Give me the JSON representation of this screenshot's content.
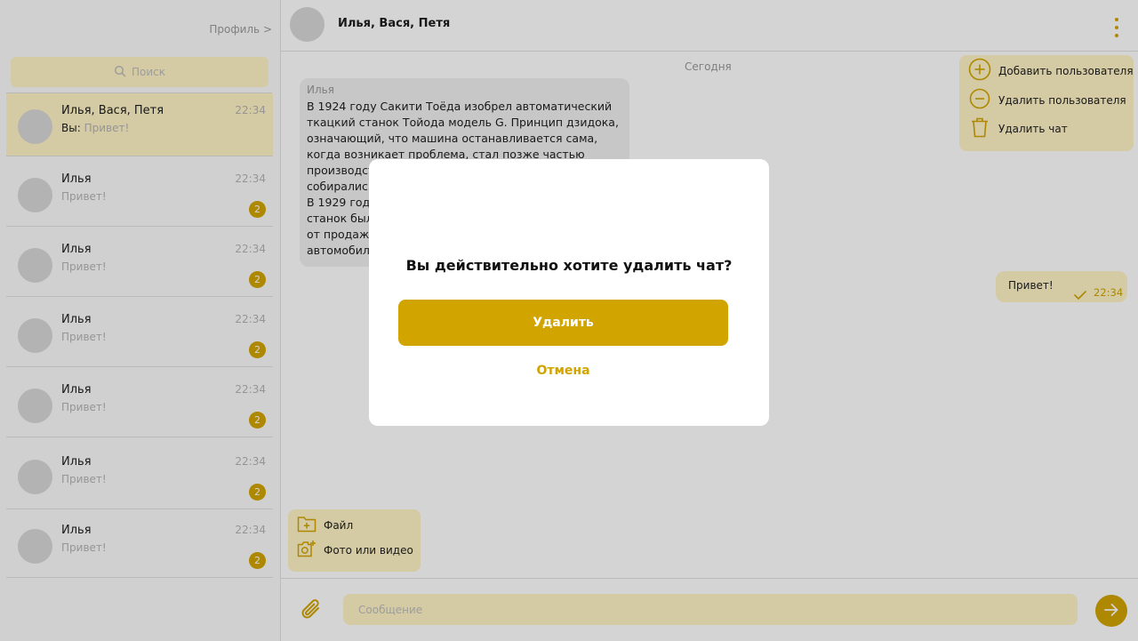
{
  "sidebar": {
    "profile_link": "Профиль >",
    "search_placeholder": "Поиск",
    "chats": [
      {
        "name": "Илья, Вася, Петя",
        "you_prefix": "Вы: ",
        "preview": "Привет!",
        "time": "22:34",
        "unread": "",
        "active": true
      },
      {
        "name": "Илья",
        "preview": "Привет!",
        "time": "22:34",
        "unread": "2"
      },
      {
        "name": "Илья",
        "preview": "Привет!",
        "time": "22:34",
        "unread": "2"
      },
      {
        "name": "Илья",
        "preview": "Привет!",
        "time": "22:34",
        "unread": "2"
      },
      {
        "name": "Илья",
        "preview": "Привет!",
        "time": "22:34",
        "unread": "2"
      },
      {
        "name": "Илья",
        "preview": "Привет!",
        "time": "22:34",
        "unread": "2"
      },
      {
        "name": "Илья",
        "preview": "Привет!",
        "time": "22:34",
        "unread": "2"
      }
    ]
  },
  "header": {
    "title": "Илья, Вася, Петя"
  },
  "conversation": {
    "date_separator": "Сегодня",
    "incoming": {
      "author": "Илья",
      "text": "В 1924 году Сакити Тоёда изобрел автоматический ткацкий станок Тойода модель G. Принцип дзидока, означающий, что машина останавливается сама, когда возникает проблема, стал позже частью производственной системы Toyota. Ткацкие станки собирались на небольшой производственной линии. В 1929 году патент на автоматический ткацкий станок был продан британской компании, а деньги от продажи существенно помогли в деле развития автомобильного производства."
    },
    "outgoing": {
      "text": "Привет!",
      "time": "22:34"
    }
  },
  "chat_menu": {
    "add_user": "Добавить пользователя",
    "remove_user": "Удалить пользователя",
    "delete_chat": "Удалить чат"
  },
  "attach_menu": {
    "file": "Файл",
    "photo_video": "Фото или видео"
  },
  "composer": {
    "placeholder": "Сообщение"
  },
  "modal": {
    "question": "Вы действительно хотите удалить чат?",
    "confirm_label": "Удалить",
    "cancel_label": "Отмена"
  },
  "colors": {
    "accent": "#d1a400",
    "accent_light": "#fff3c4",
    "overlay": "rgba(0,0,0,0.17)"
  }
}
